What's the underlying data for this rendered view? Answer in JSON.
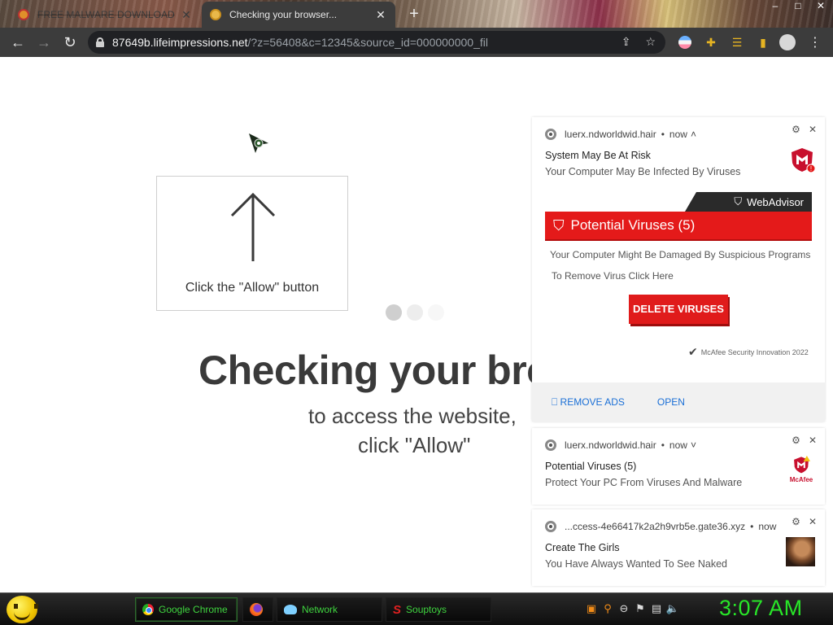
{
  "browser": {
    "tabs": [
      {
        "title": "FREE MALWARE DOWNLOAD",
        "active": false
      },
      {
        "title": "Checking your browser...",
        "active": true
      }
    ],
    "new_tab_icon": "plus-icon",
    "window_controls": {
      "minimize": "–",
      "restore": "□",
      "close": "✕"
    },
    "address_bar": {
      "host": "87649b.lifeimpressions.net",
      "path": "/?z=56408&c=12345&source_id=000000000_fil"
    }
  },
  "page": {
    "allow_prompt": "Click the \"Allow\" button",
    "heading": "Checking your bro",
    "subtext_line1": "to access the website,",
    "subtext_line2": "click \"Allow\""
  },
  "notifications": [
    {
      "source": "luerx.ndworldwid.hair",
      "time": "now",
      "title": "System May Be At Risk",
      "message": "Your Computer May Be Infected By Viruses",
      "brand_badge": "WebAdvisor",
      "alert_title": "Potential Viruses (5)",
      "body_line1": "Your Computer Might Be Damaged By Suspicious Programs",
      "body_line2": "To Remove Virus Click Here",
      "cta": "DELETE VIRUSES",
      "footer": "McAfee Security Innovation 2022",
      "actions": {
        "remove_ads": "⎕ REMOVE ADS",
        "open": "OPEN"
      }
    },
    {
      "source": "luerx.ndworldwid.hair",
      "time": "now",
      "title": "Potential Viruses (5)",
      "message": "Protect Your PC From Viruses And Malware",
      "brand": "McAfee"
    },
    {
      "source": "...ccess-4e66417k2a2h9vrb5e.gate36.xyz",
      "time": "now",
      "title": "Create The Girls",
      "message": "You Have Always Wanted To See Naked"
    }
  ],
  "taskbar": {
    "items": [
      {
        "label": "Google Chrome",
        "icon": "chrome-icon"
      },
      {
        "label": "",
        "icon": "firefox-icon"
      },
      {
        "label": "Network",
        "icon": "network-icon"
      },
      {
        "label": "Souptoys",
        "icon": "souptoys-icon"
      }
    ],
    "clock": "3:07 AM"
  },
  "colors": {
    "mcafee_red": "#e41a1a",
    "clock_green": "#28e628",
    "toolbar_dark": "#3c3c3c"
  }
}
